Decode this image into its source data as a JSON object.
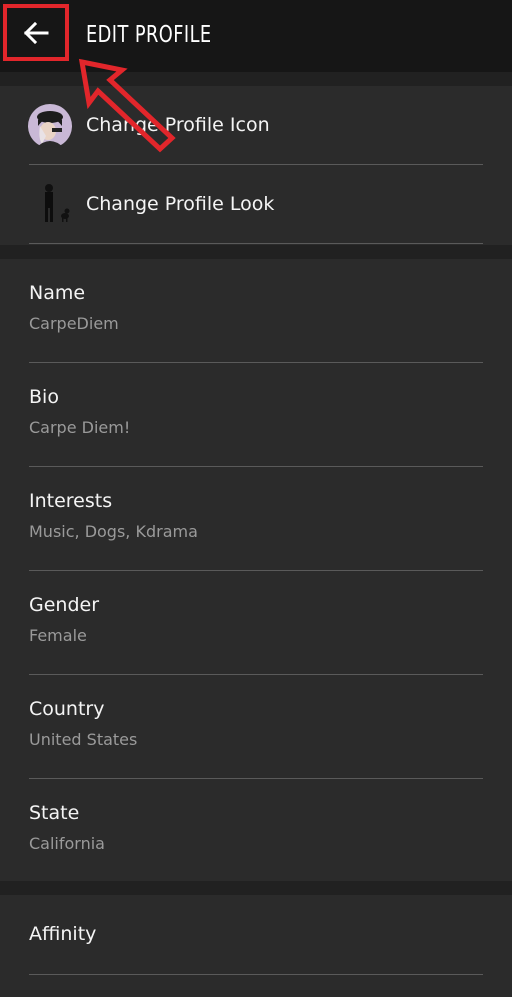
{
  "header": {
    "title": "EDIT PROFILE"
  },
  "profile_rows": [
    {
      "label": "Change Profile Icon"
    },
    {
      "label": "Change Profile Look"
    }
  ],
  "fields": [
    {
      "label": "Name",
      "value": "CarpeDiem"
    },
    {
      "label": "Bio",
      "value": "Carpe Diem!"
    },
    {
      "label": "Interests",
      "value": "Music, Dogs, Kdrama"
    },
    {
      "label": "Gender",
      "value": "Female"
    },
    {
      "label": "Country",
      "value": "United States"
    },
    {
      "label": "State",
      "value": "California"
    }
  ],
  "extra": {
    "affinity_label": "Affinity"
  },
  "icons": {
    "back": "arrow-left-icon",
    "profile_icon": "avatar-thumbnail",
    "profile_look": "avatar-full-body-thumbnail",
    "annotation": "red-pointer-arrow"
  },
  "colors": {
    "highlight": "#e2262b",
    "header_bg": "#161616",
    "row_bg": "#2b2b2b"
  }
}
